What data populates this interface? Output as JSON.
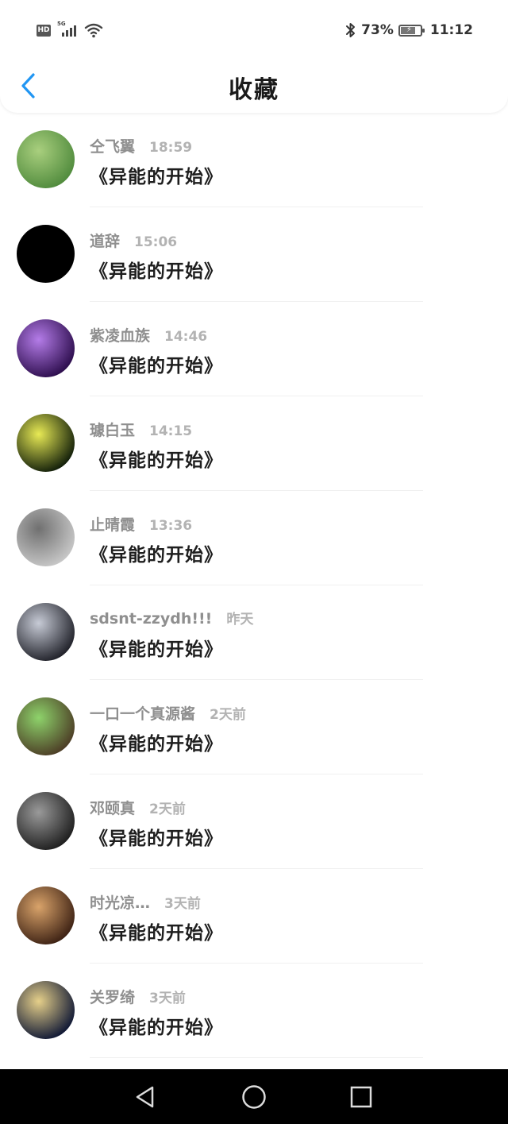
{
  "status_bar": {
    "hd_label": "HD",
    "network_label": "5G",
    "battery_percent": "73%",
    "battery_level": 0.73,
    "time": "11:12",
    "icons": [
      "hd-icon",
      "signal-icon",
      "wifi-icon",
      "bluetooth-icon",
      "battery-icon"
    ]
  },
  "header": {
    "title": "收藏",
    "back_icon": "chevron-left-icon",
    "accent": "#2196f3"
  },
  "favorites": [
    {
      "name": "仝飞翼",
      "time": "18:59",
      "book": "《异能的开始》",
      "avatar_colors": [
        "#4f8a3c",
        "#a9cf7e"
      ]
    },
    {
      "name": "道辞",
      "time": "15:06",
      "book": "《异能的开始》",
      "avatar_colors": [
        "#000000",
        "#000000"
      ]
    },
    {
      "name": "紫凌血族",
      "time": "14:46",
      "book": "《异能的开始》",
      "avatar_colors": [
        "#2a0b4a",
        "#b47ce8"
      ]
    },
    {
      "name": "璩白玉",
      "time": "14:15",
      "book": "《异能的开始》",
      "avatar_colors": [
        "#0d1a08",
        "#e8ea55"
      ]
    },
    {
      "name": "止晴霞",
      "time": "13:36",
      "book": "《异能的开始》",
      "avatar_colors": [
        "#c9c9c9",
        "#707070"
      ]
    },
    {
      "name": "sdsnt-zzydh!!!",
      "time": "昨天",
      "book": "《异能的开始》",
      "avatar_colors": [
        "#1d1e26",
        "#c7cbd6"
      ]
    },
    {
      "name": "一口一个真源酱",
      "time": "2天前",
      "book": "《异能的开始》",
      "avatar_colors": [
        "#4b3a24",
        "#8ed36b"
      ]
    },
    {
      "name": "邓颐真",
      "time": "2天前",
      "book": "《异能的开始》",
      "avatar_colors": [
        "#1c1c1c",
        "#9a9a9a"
      ]
    },
    {
      "name": "时光凉…",
      "time": "3天前",
      "book": "《异能的开始》",
      "avatar_colors": [
        "#3a1f12",
        "#d9a36a"
      ]
    },
    {
      "name": "关罗绮",
      "time": "3天前",
      "book": "《异能的开始》",
      "avatar_colors": [
        "#0b1433",
        "#e6d08a"
      ]
    }
  ],
  "nav_bar": {
    "icons": [
      "back-triangle-icon",
      "home-circle-icon",
      "recents-square-icon"
    ]
  }
}
